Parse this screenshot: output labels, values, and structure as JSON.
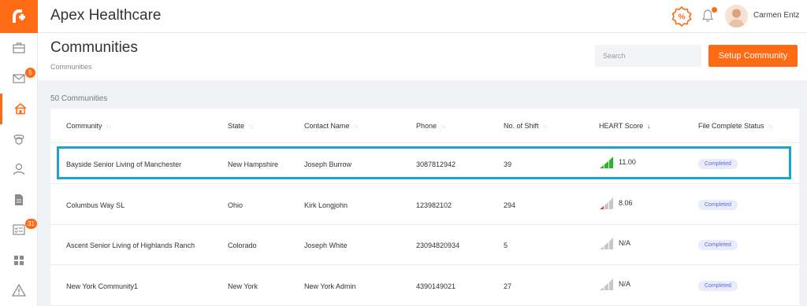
{
  "app": {
    "title": "Apex Healthcare"
  },
  "user": {
    "name": "Carmen Entz"
  },
  "sidebar": {
    "items": [
      {
        "name": "briefcase-icon",
        "badge": ""
      },
      {
        "name": "mail-icon",
        "badge": "5"
      },
      {
        "name": "community-icon",
        "badge": "",
        "active": true
      },
      {
        "name": "nurse-icon",
        "badge": ""
      },
      {
        "name": "person-icon",
        "badge": ""
      },
      {
        "name": "document-icon",
        "badge": ""
      },
      {
        "name": "checklist-icon",
        "badge": "31"
      },
      {
        "name": "grid-icon",
        "badge": ""
      },
      {
        "name": "warning-icon",
        "badge": ""
      }
    ]
  },
  "page": {
    "title": "Communities",
    "breadcrumb": "Communities",
    "search_placeholder": "Search",
    "setup_label": "Setup Community",
    "count": "50 Communities"
  },
  "table": {
    "headers": [
      "Community",
      "State",
      "Contact Name",
      "Phone",
      "No. of Shift",
      "HEART Score",
      "File Complete Status"
    ],
    "sorted_column": 5,
    "rows": [
      {
        "community": "Bayside Senior Living of Manchester",
        "state": "New Hampshire",
        "contact": "Joseph Burrow",
        "phone": "3087812942",
        "shifts": "39",
        "score": "11.00",
        "score_level": 3,
        "status": "Completed"
      },
      {
        "community": "Columbus Way SL",
        "state": "Ohio",
        "contact": "Kirk Longjohn",
        "phone": "123982102",
        "shifts": "294",
        "score": "8.06",
        "score_level": 1,
        "status": "Completed"
      },
      {
        "community": "Ascent Senior Living of Highlands Ranch",
        "state": "Colorado",
        "contact": "Joseph White",
        "phone": "23094820934",
        "shifts": "5",
        "score": "N/A",
        "score_level": 0,
        "status": "Completed"
      },
      {
        "community": "New York Community1",
        "state": "New York",
        "contact": "New York Admin",
        "phone": "4390149021",
        "shifts": "27",
        "score": "N/A",
        "score_level": 0,
        "status": "Completed"
      }
    ]
  },
  "colors": {
    "accent": "#ff6a14",
    "highlight": "#1aa5c9",
    "score_green": "#2bb52b",
    "score_red": "#e53935",
    "badge_bg": "#e9ecfb",
    "badge_text": "#5b6bd6"
  }
}
